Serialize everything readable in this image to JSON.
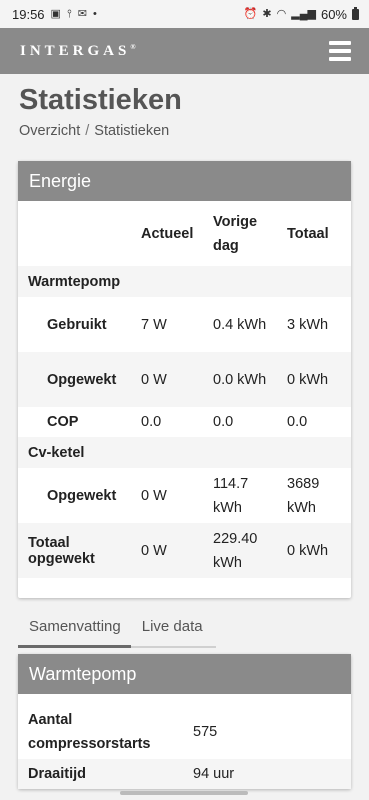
{
  "statusbar": {
    "time": "19:56",
    "battery": "60%"
  },
  "header": {
    "logo": "INTERGAS",
    "logo_mark": "®"
  },
  "page": {
    "title": "Statistieken"
  },
  "breadcrumb": {
    "home": "Overzicht",
    "separator": "/",
    "current": "Statistieken"
  },
  "energy": {
    "title": "Energie",
    "columns": [
      "",
      "Actueel",
      "Vorige dag",
      "Totaal"
    ],
    "sections": {
      "warmtepomp": "Warmtepomp",
      "cvketel": "Cv-ketel"
    },
    "rows": {
      "gebruikt": {
        "label": "Gebruikt",
        "actueel": "7 W",
        "vorige": "0.4 kWh",
        "totaal": "3 kWh"
      },
      "opgewekt": {
        "label": "Opgewekt",
        "actueel": "0 W",
        "vorige": "0.0 kWh",
        "totaal": "0 kWh"
      },
      "cop": {
        "label": "COP",
        "actueel": "0.0",
        "vorige": "0.0",
        "totaal": "0.0"
      },
      "cv_opgewekt": {
        "label": "Opgewekt",
        "actueel": "0 W",
        "vorige": "114.7 kWh",
        "totaal": "3689 kWh"
      },
      "totaal_opgewekt": {
        "label": "Totaal opgewekt",
        "actueel": "0 W",
        "vorige": "229.40 kWh",
        "totaal": "0 kWh"
      }
    }
  },
  "tabs": [
    {
      "label": "Samenvatting",
      "active": true
    },
    {
      "label": "Live data",
      "active": false
    }
  ],
  "warmtepomp": {
    "title": "Warmtepomp",
    "rows": [
      {
        "key": "Aantal compressorstarts",
        "value": "575"
      },
      {
        "key": "Draaitijd",
        "value": "94 uur"
      }
    ]
  }
}
